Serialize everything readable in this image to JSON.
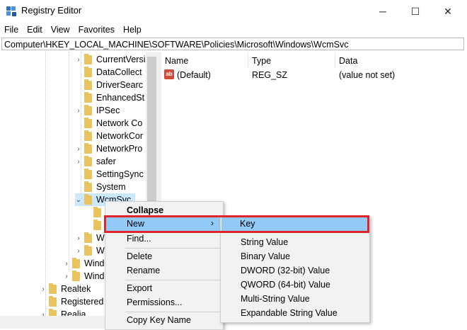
{
  "window": {
    "title": "Registry Editor",
    "minimize_glyph": "─",
    "maximize_glyph": "☐",
    "close_glyph": "✕"
  },
  "menubar": [
    "File",
    "Edit",
    "View",
    "Favorites",
    "Help"
  ],
  "address": "Computer\\HKEY_LOCAL_MACHINE\\SOFTWARE\\Policies\\Microsoft\\Windows\\WcmSvc",
  "tree": {
    "items": [
      {
        "label": "CurrentVersi",
        "expander": "›"
      },
      {
        "label": "DataCollect",
        "expander": ""
      },
      {
        "label": "DriverSearc",
        "expander": ""
      },
      {
        "label": "EnhancedSt",
        "expander": ""
      },
      {
        "label": "IPSec",
        "expander": "›"
      },
      {
        "label": "Network Co",
        "expander": ""
      },
      {
        "label": "NetworkCor",
        "expander": ""
      },
      {
        "label": "NetworkPro",
        "expander": "›"
      },
      {
        "label": "safer",
        "expander": "›"
      },
      {
        "label": "SettingSync",
        "expander": ""
      },
      {
        "label": "System",
        "expander": ""
      },
      {
        "label": "WcmSvc",
        "expander": "⌄"
      },
      {
        "label": "",
        "expander": ""
      },
      {
        "label": "",
        "expander": ""
      },
      {
        "label": "W",
        "expander": "›"
      },
      {
        "label": "W",
        "expander": "›"
      },
      {
        "label": "Wind",
        "expander": "›"
      },
      {
        "label": "Wind",
        "expander": "›"
      },
      {
        "label": "Realtek",
        "expander": "›"
      },
      {
        "label": "Registered",
        "expander": ""
      },
      {
        "label": "Realia",
        "expander": "›"
      }
    ]
  },
  "values_pane": {
    "columns": [
      "Name",
      "Type",
      "Data"
    ],
    "rows": [
      {
        "icon": "ab",
        "name": "(Default)",
        "type": "REG_SZ",
        "data": "(value not set)"
      }
    ]
  },
  "context_menu": {
    "items": [
      "Collapse",
      "New",
      "Find...",
      "Delete",
      "Rename",
      "Export",
      "Permissions...",
      "Copy Key Name"
    ],
    "new_arrow": "›"
  },
  "submenu": {
    "items": [
      "Key",
      "String Value",
      "Binary Value",
      "DWORD (32-bit) Value",
      "QWORD (64-bit) Value",
      "Multi-String Value",
      "Expandable String Value"
    ]
  },
  "colors": {
    "highlight_box": "#e0262b",
    "selection": "#91c9f7",
    "folder": "#e8c35e"
  }
}
